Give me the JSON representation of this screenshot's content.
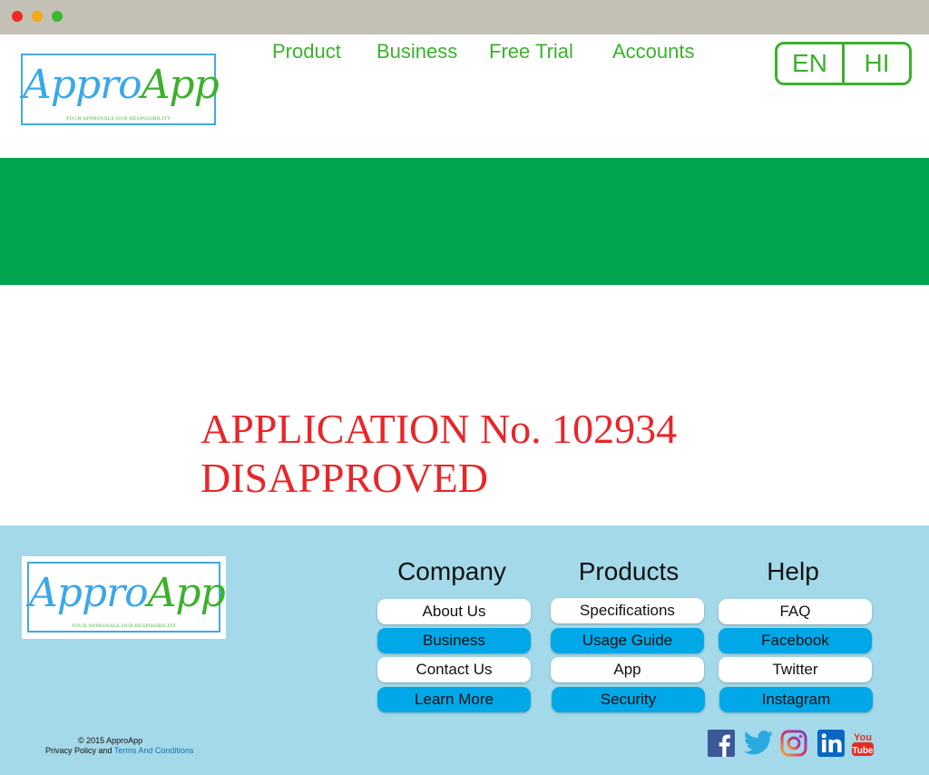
{
  "window": {
    "controls": [
      "close",
      "minimize",
      "maximize"
    ]
  },
  "brand": {
    "logo_part1": "Appro",
    "logo_part2": "App",
    "tagline": "YOUR APPROVALS OUR RESPOSIBILITY",
    "colors": {
      "green": "#3bb12c",
      "blue": "#3aa8ea",
      "banner": "#00a550",
      "footer_bg": "#a3d9e8",
      "button_blue": "#00a8e8",
      "alert_red": "#e8262a"
    }
  },
  "nav": {
    "items": [
      "Product",
      "Business",
      "Free Trial",
      "Accounts"
    ]
  },
  "language": {
    "options": [
      "EN",
      "HI"
    ]
  },
  "message": {
    "line1": "APPLICATION No. 102934",
    "line2": "DISAPPROVED"
  },
  "footer": {
    "columns": [
      {
        "title": "Company",
        "items": [
          "About Us",
          "Business",
          "Contact Us",
          "Learn More"
        ]
      },
      {
        "title": "Products",
        "items": [
          "Specifications",
          "Usage Guide",
          "App",
          "Security"
        ]
      },
      {
        "title": "Help",
        "items": [
          "FAQ",
          "Facebook",
          "Twitter",
          "Instagram"
        ]
      }
    ],
    "copyright": "© 2015  ApproApp",
    "legal_prefix": "Privacy Policy and ",
    "legal_link": "Terms And Conditions",
    "social": [
      "facebook-icon",
      "twitter-icon",
      "instagram-icon",
      "linkedin-icon",
      "youtube-icon"
    ]
  }
}
